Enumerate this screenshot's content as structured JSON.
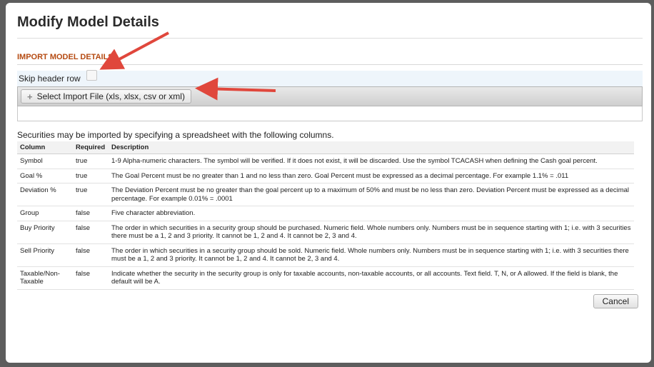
{
  "dialog": {
    "title": "Modify Model Details",
    "section_title": "IMPORT MODEL DETAILS",
    "skip_header_label": "Skip header row",
    "select_file_label": "Select Import File (xls, xlsx, csv or xml)",
    "intro_text": "Securities may be imported by specifying a spreadsheet with the following columns.",
    "cancel_label": "Cancel"
  },
  "table": {
    "headers": [
      "Column",
      "Required",
      "Description"
    ],
    "rows": [
      {
        "column": "Symbol",
        "required": "true",
        "description": "1-9 Alpha-numeric characters. The symbol will be verified. If it does not exist, it will be discarded. Use the symbol TCACASH when defining the Cash goal percent."
      },
      {
        "column": "Goal %",
        "required": "true",
        "description": "The Goal Percent must be no greater than 1 and no less than zero. Goal Percent must be expressed as a decimal percentage. For example 1.1% = .011"
      },
      {
        "column": "Deviation %",
        "required": "true",
        "description": "The Deviation Percent must be no greater than the goal percent up to a maximum of 50% and must be no less than zero. Deviation Percent must be expressed as a decimal percentage. For example 0.01% = .0001"
      },
      {
        "column": "Group",
        "required": "false",
        "description": "Five character abbreviation."
      },
      {
        "column": "Buy Priority",
        "required": "false",
        "description": "The order in which securities in a security group should be purchased. Numeric field. Whole numbers only. Numbers must be in sequence starting with 1; i.e. with 3 securities there must be a 1, 2 and 3 priority. It cannot be 1, 2 and 4. It cannot be 2, 3 and 4."
      },
      {
        "column": "Sell Priority",
        "required": "false",
        "description": "The order in which securities in a security group should be sold. Numeric field. Whole numbers only. Numbers must be in sequence starting with 1; i.e. with 3 securities there must be a 1, 2 and 3 priority. It cannot be 1, 2 and 4. It cannot be 2, 3 and 4."
      },
      {
        "column": "Taxable/Non-Taxable",
        "required": "false",
        "description": "Indicate whether the security in the security group is only for taxable accounts, non-taxable accounts, or all accounts. Text field. T, N, or A allowed. If the field is blank, the default will be A."
      }
    ]
  },
  "colors": {
    "accent": "#b54a11",
    "arrow": "#e0473c"
  }
}
